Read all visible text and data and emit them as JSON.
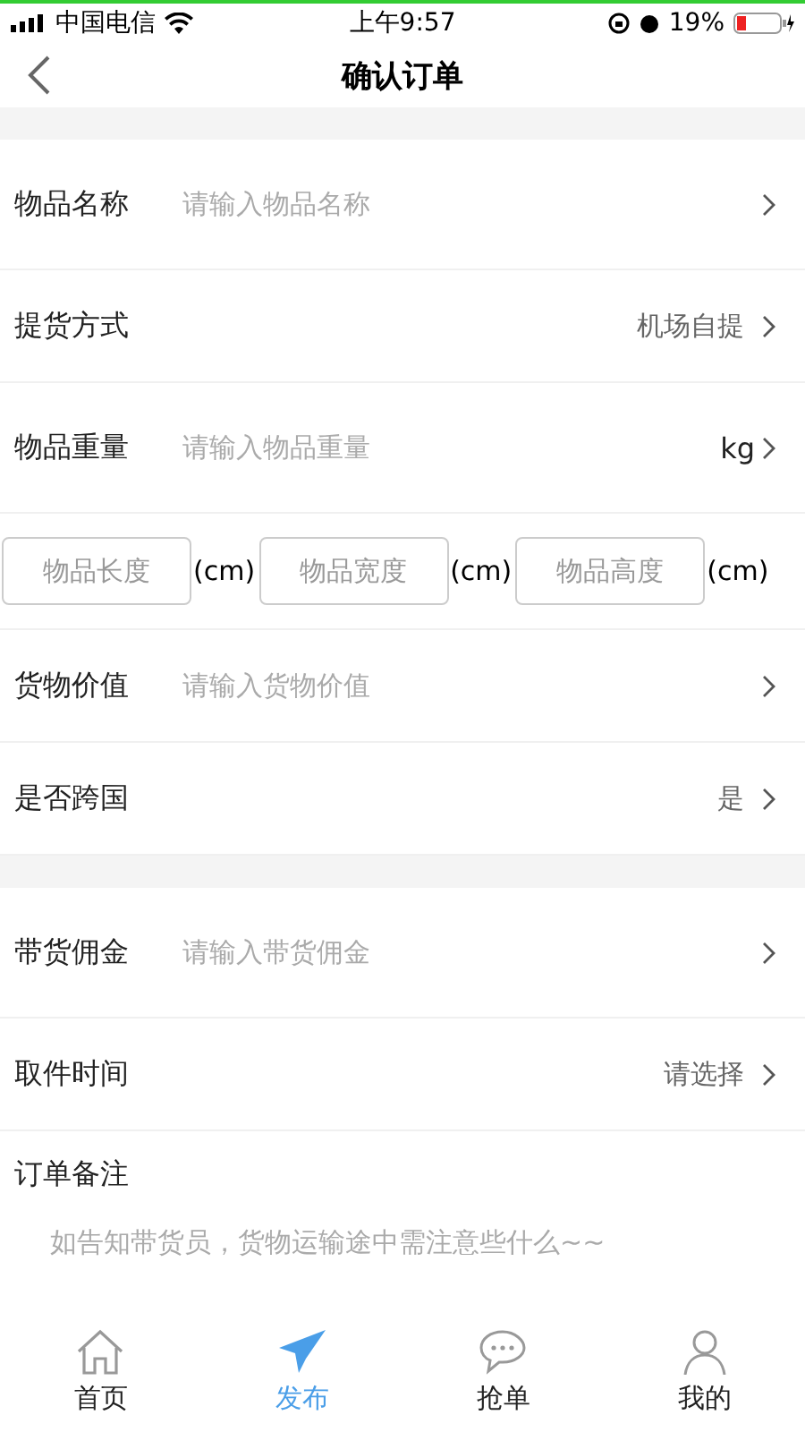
{
  "status_bar": {
    "carrier": "中国电信",
    "time": "上午9:57",
    "battery": "19%"
  },
  "nav": {
    "title": "确认订单"
  },
  "sections": [
    {
      "rows": [
        {
          "kind": "input",
          "label": "物品名称",
          "placeholder": "请输入物品名称"
        },
        {
          "kind": "select",
          "label": "提货方式",
          "value": "机场自提"
        },
        {
          "kind": "input",
          "label": "物品重量",
          "placeholder": "请输入物品重量",
          "unit": "kg"
        },
        {
          "kind": "dims",
          "fields": [
            {
              "placeholder": "物品长度",
              "unit": "(cm)"
            },
            {
              "placeholder": "物品宽度",
              "unit": "(cm)"
            },
            {
              "placeholder": "物品高度",
              "unit": "(cm)"
            }
          ]
        },
        {
          "kind": "input",
          "label": "货物价值",
          "placeholder": "请输入货物价值"
        },
        {
          "kind": "select",
          "label": "是否跨国",
          "value": "是"
        }
      ]
    },
    {
      "rows": [
        {
          "kind": "input",
          "label": "带货佣金",
          "placeholder": "请输入带货佣金"
        },
        {
          "kind": "select",
          "label": "取件时间",
          "value": "请选择"
        },
        {
          "kind": "note",
          "label": "订单备注",
          "placeholder": "如告知带货员，货物运输途中需注意些什么~~"
        }
      ]
    }
  ],
  "tabs": [
    {
      "label": "首页",
      "selected": false
    },
    {
      "label": "发布",
      "selected": true
    },
    {
      "label": "抢单",
      "selected": false
    },
    {
      "label": "我的",
      "selected": false
    }
  ]
}
